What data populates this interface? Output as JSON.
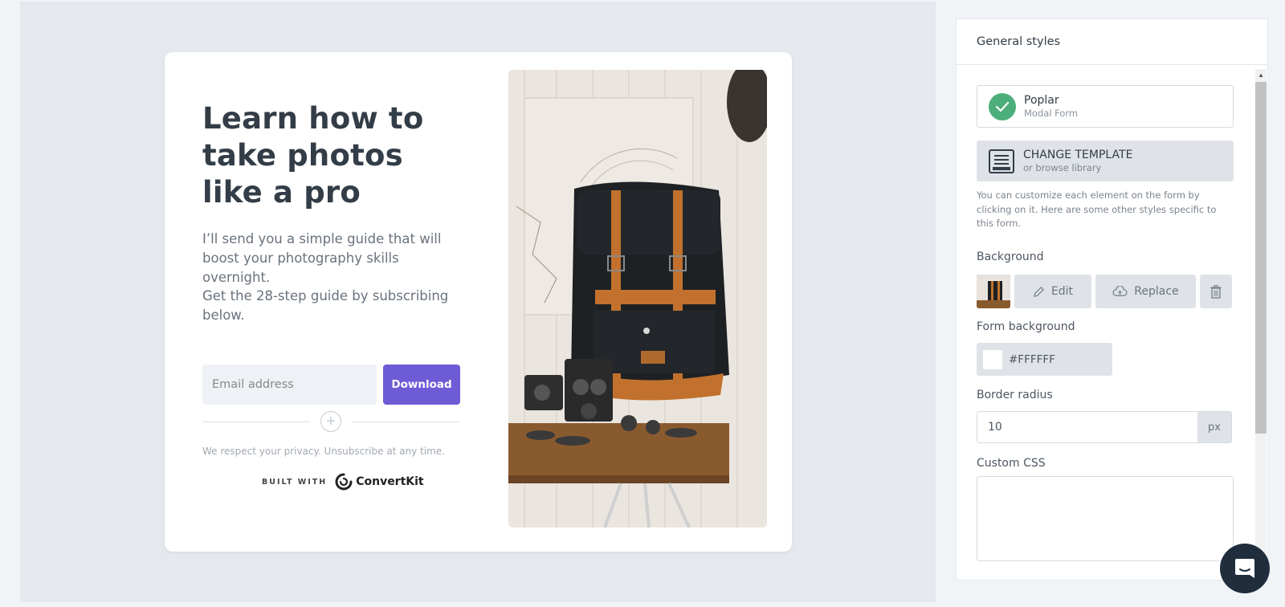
{
  "form": {
    "headline": "Learn how to take photos like a pro",
    "subtext_1": "I’ll send you a simple guide that will boost your photography skills overnight.",
    "subtext_2": "Get the 28-step guide by subscribing below.",
    "email_placeholder": "Email address",
    "download_label": "Download",
    "privacy": "We respect your privacy. Unsubscribe at any time.",
    "built_with": "BUILT WITH",
    "brand": "ConvertKit",
    "button_color": "#6e5bd6"
  },
  "panel": {
    "title": "General styles",
    "template": {
      "name": "Poplar",
      "type": "Modal Form"
    },
    "change_template": {
      "title": "CHANGE TEMPLATE",
      "subtitle": "or browse library"
    },
    "help_text": "You can customize each element on the form by clicking on it. Here are some other styles specific to this form.",
    "background": {
      "label": "Background",
      "edit_label": "Edit",
      "replace_label": "Replace"
    },
    "form_background": {
      "label": "Form background",
      "value": "#FFFFFF"
    },
    "border_radius": {
      "label": "Border radius",
      "value": "10",
      "unit": "px"
    },
    "custom_css": {
      "label": "Custom CSS",
      "value": ""
    }
  },
  "icons": {
    "check": "check-icon",
    "template": "template-icon",
    "edit": "pencil-icon",
    "replace": "cloud-upload-icon",
    "delete": "trash-icon",
    "add": "plus-circle-icon",
    "chat": "chat-icon"
  }
}
